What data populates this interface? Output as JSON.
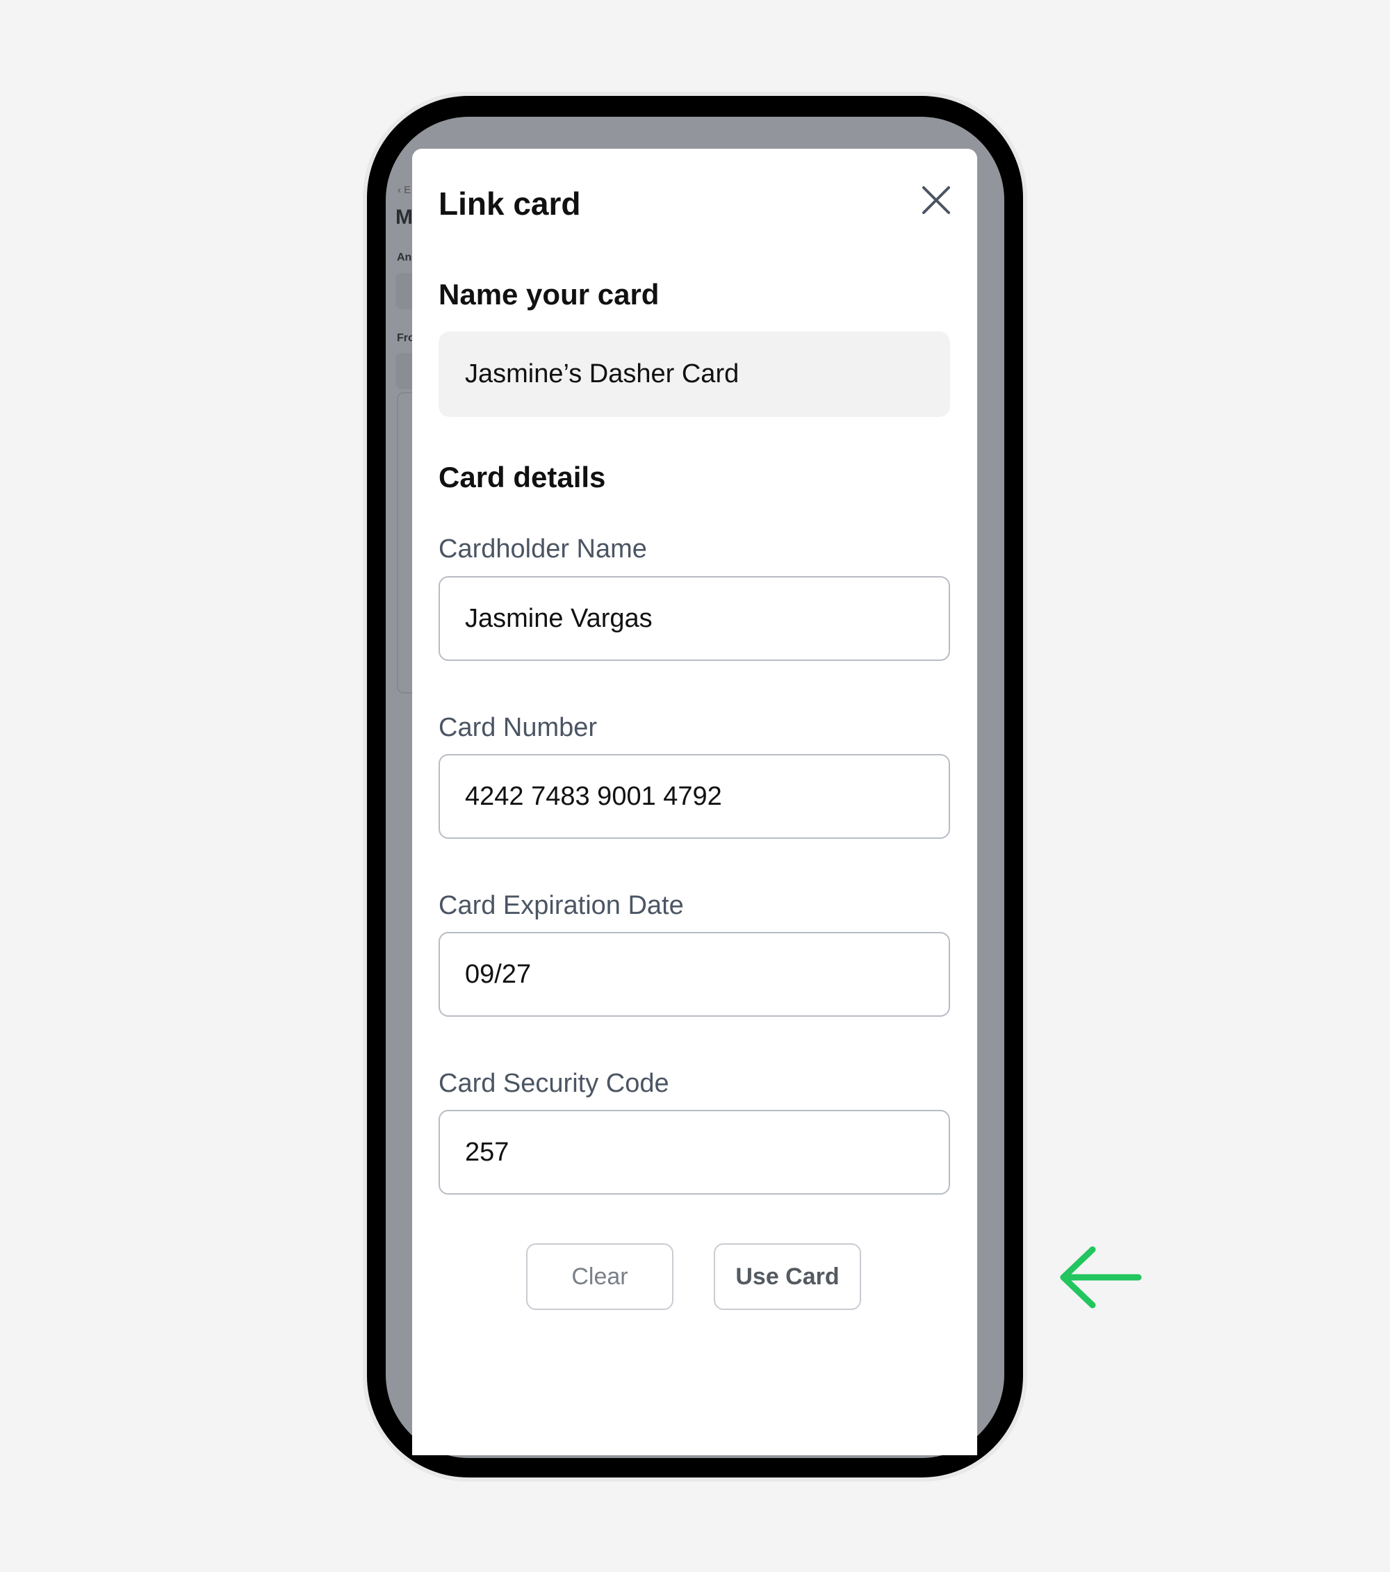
{
  "background_app": {
    "back_label": "‹ E",
    "title_fragment": "M",
    "label_1": "An",
    "label_2": "Fro"
  },
  "sheet": {
    "title": "Link card",
    "close_icon": "close-icon",
    "name_section": {
      "heading": "Name your card",
      "value": "Jasmine’s Dasher  Card"
    },
    "details_section": {
      "heading": "Card details",
      "fields": {
        "cardholder": {
          "label": "Cardholder Name",
          "value": "Jasmine Vargas"
        },
        "number": {
          "label": "Card Number",
          "value": "4242 7483 9001 4792"
        },
        "expiry": {
          "label": "Card Expiration Date",
          "value": "09/27"
        },
        "security": {
          "label": "Card Security Code",
          "value": "257"
        }
      }
    },
    "buttons": {
      "clear_label": "Clear",
      "use_label": "Use Card"
    }
  },
  "annotation": {
    "icon": "arrow-left-icon",
    "color": "#22c55e"
  },
  "colors": {
    "page_bg": "#f4f4f4",
    "phone_frame": "#000000",
    "overlay": "#92959b",
    "label_text": "#4b5563",
    "input_border": "#b8bcc4"
  }
}
